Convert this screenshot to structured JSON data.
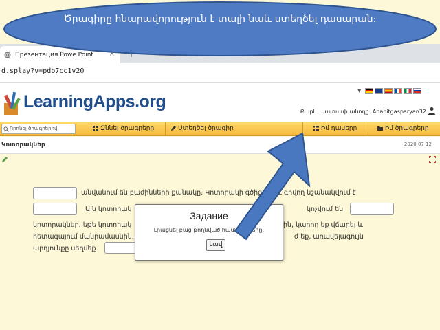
{
  "banner": {
    "text": "Ծրագիրը հնարավորություն է տալի նաև ստեղծել դասարան։"
  },
  "browser": {
    "tab_title": "Презентация Powe Point",
    "tab_close": "×",
    "new_tab": "+",
    "url": "d.splay?v=pdb7cc1v20"
  },
  "site": {
    "logo": "LearningApps.org",
    "user_label": "Բարև պատասխանողը. Anahitgasparyan32",
    "search_placeholder": "Որոնել ծրագրերով"
  },
  "nav": {
    "browse": "Զննել ծրագրերը",
    "create": "Ստեղծել ծրագիր",
    "classes": "Իմ դասերը",
    "my_apps": "Իմ ծրագրերը"
  },
  "page": {
    "title": "Կոտորակներ",
    "date": "2020 07 12"
  },
  "exercise": {
    "line1": "անվանում են բաժինների քանակը։ Կոտորակի գծից վերև գրվող նշանակվում է",
    "line2": "Այն կոտորակ",
    "line2b": "կոչվում են",
    "line3": "կոտորակներ. եթե կոտորակ",
    "line3b": "ին, կարող եք վճարել և",
    "line4": "հետագայում մանրամասնին. որ",
    "line4b": "ժ եք, առավելագույն",
    "line5": "արդյունքը սեղմեք"
  },
  "dialog": {
    "title": "Задание",
    "message": "Լրացնել բաց թողնված հատվածները։",
    "ok_label": "Լավ"
  }
}
